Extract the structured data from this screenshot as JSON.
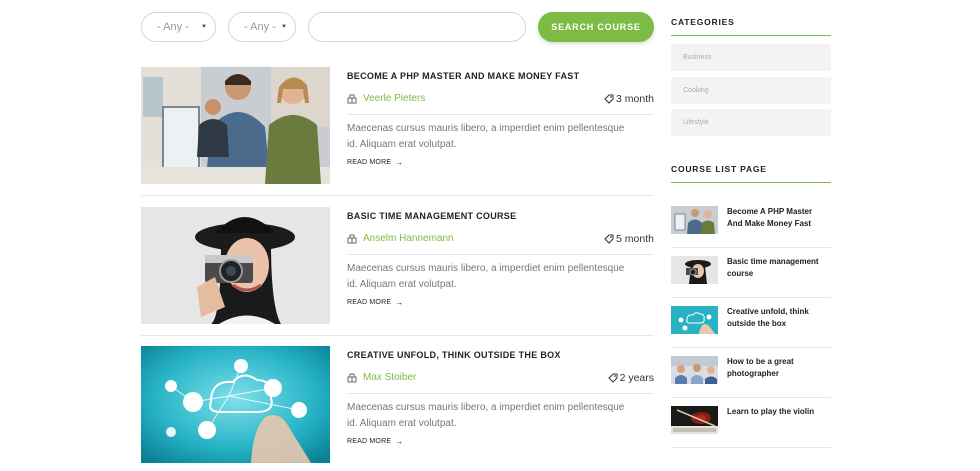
{
  "search": {
    "select_one": "- Any -",
    "select_two": "- Any -",
    "input_value": "",
    "input_placeholder": "",
    "button_label": "SEARCH COURSE"
  },
  "courses": [
    {
      "title": "BECOME A PHP MASTER AND MAKE MONEY FAST",
      "author": "Veerle Pieters",
      "duration": "3 month",
      "description": "Maecenas cursus mauris libero, a imperdiet enim pellentesque id. Aliquam erat volutpat.",
      "read_more": "READ MORE"
    },
    {
      "title": "BASIC TIME MANAGEMENT COURSE",
      "author": "Anselm Hannemann",
      "duration": "5 month",
      "description": "Maecenas cursus mauris libero, a imperdiet enim pellentesque id. Aliquam erat volutpat.",
      "read_more": "READ MORE"
    },
    {
      "title": "CREATIVE UNFOLD, THINK OUTSIDE THE BOX",
      "author": "Max Stoiber",
      "duration": "2 years",
      "description": "Maecenas cursus mauris libero, a imperdiet enim pellentesque id. Aliquam erat volutpat.",
      "read_more": "READ MORE"
    }
  ],
  "sidebar": {
    "categories_title": "CATEGORIES",
    "categories": [
      "Business",
      "Cooking",
      "Lifestyle"
    ],
    "course_list_title": "COURSE LIST PAGE",
    "course_list": [
      "Become A PHP Master And Make Money Fast",
      "Basic time management course",
      "Creative unfold, think outside the box",
      "How to be a great photographer",
      "Learn to play the violin"
    ]
  },
  "colors": {
    "accent": "#7cbb44",
    "text_dark": "#222222",
    "text_muted": "#777777",
    "category_bg": "#f3f3f3"
  },
  "icons": {
    "author": "user-badge-icon",
    "duration": "tag-icon",
    "read_more": "arrow-right-icon",
    "select": "caret-down-icon"
  }
}
